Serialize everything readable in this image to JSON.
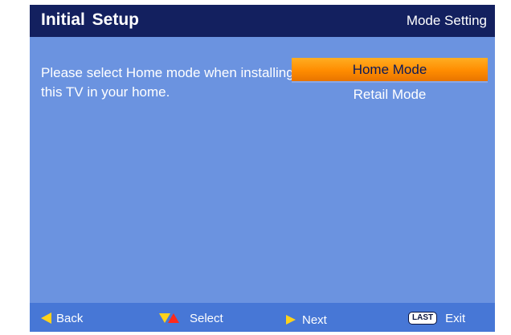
{
  "header": {
    "title": "Initial  Setup",
    "subtitle": "Mode Setting"
  },
  "main": {
    "instruction": "Please select Home mode when installing this TV in your home.",
    "options": [
      {
        "label": "Home Mode",
        "selected": true
      },
      {
        "label": "Retail Mode",
        "selected": false
      }
    ]
  },
  "footer": {
    "back_label": "Back",
    "select_label": "Select",
    "next_label": "Next",
    "last_key_label": "LAST",
    "exit_label": "Exit"
  },
  "colors": {
    "screen_bg": "#6b93e0",
    "header_bg": "#13205f",
    "footer_bg": "#4777d6",
    "selected_bg": "#ff8c00",
    "arrow_yellow": "#ffd21a",
    "arrow_red": "#ff2a1a"
  },
  "icons": {
    "back": "left-arrow-icon",
    "select": "up-down-arrows-icon",
    "next": "right-arrow-icon",
    "exit": "last-key-icon"
  }
}
